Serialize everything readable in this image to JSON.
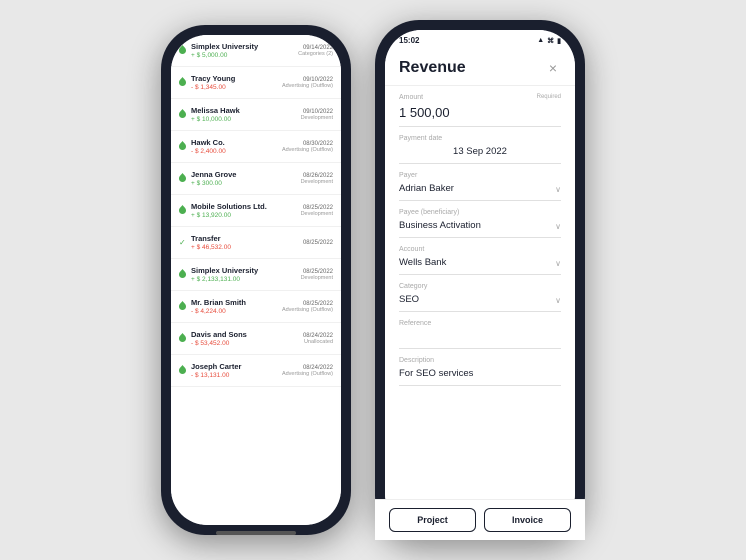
{
  "phone1": {
    "transactions": [
      {
        "id": 1,
        "name": "Simplex University",
        "amount": "+ $ 5,000.00",
        "type": "positive",
        "date": "09/14/2022",
        "category": "Categories (2)",
        "icon": "leaf"
      },
      {
        "id": 2,
        "name": "Tracy Young",
        "amount": "- $ 1,345.00",
        "type": "negative",
        "date": "09/10/2022",
        "category": "Advertising (Outflow)",
        "icon": "leaf"
      },
      {
        "id": 3,
        "name": "Melissa Hawk",
        "amount": "+ $ 10,000.00",
        "type": "positive",
        "date": "09/10/2022",
        "category": "Development",
        "icon": "leaf"
      },
      {
        "id": 4,
        "name": "Hawk Co.",
        "amount": "- $ 2,400.00",
        "type": "negative",
        "date": "08/30/2022",
        "category": "Advertising (Outflow)",
        "icon": "leaf"
      },
      {
        "id": 5,
        "name": "Jenna Grove",
        "amount": "+ $ 300.00",
        "type": "positive",
        "date": "08/26/2022",
        "category": "Development",
        "icon": "leaf"
      },
      {
        "id": 6,
        "name": "Mobile Solutions Ltd.",
        "amount": "+ $ 13,920.00",
        "type": "positive",
        "date": "08/25/2022",
        "category": "Development",
        "icon": "leaf"
      },
      {
        "id": 7,
        "name": "Transfer",
        "amount": "+ $ 46,532.00",
        "type": "negative",
        "date": "08/25/2022",
        "category": "",
        "icon": "check"
      },
      {
        "id": 8,
        "name": "Simplex University",
        "amount": "+ $ 2,133,131.00",
        "type": "positive",
        "date": "08/25/2022",
        "category": "Development",
        "icon": "leaf"
      },
      {
        "id": 9,
        "name": "Mr. Brian Smith",
        "amount": "- $ 4,224.00",
        "type": "negative",
        "date": "08/25/2022",
        "category": "Advertising (Outflow)",
        "icon": "leaf"
      },
      {
        "id": 10,
        "name": "Davis and Sons",
        "amount": "- $ 53,452.00",
        "type": "negative",
        "date": "08/24/2022",
        "category": "Unallocated",
        "icon": "leaf"
      },
      {
        "id": 11,
        "name": "Joseph Carter",
        "amount": "- $ 13,131.00",
        "type": "negative",
        "date": "08/24/2022",
        "category": "Advertising (Outflow)",
        "icon": "leaf"
      }
    ]
  },
  "phone2": {
    "statusBar": {
      "time": "15:02",
      "signal": "●●●",
      "wifi": "wifi",
      "battery": "▮▮▮"
    },
    "form": {
      "title": "Revenue",
      "close_label": "×",
      "fields": {
        "amount_label": "Amount",
        "amount_value": "1 500,00",
        "amount_required": "Required",
        "payment_date_label": "Payment date",
        "payment_date_value": "13 Sep 2022",
        "payer_label": "Payer",
        "payer_value": "Adrian Baker",
        "payee_label": "Payee (beneficiary)",
        "payee_value": "Business Activation",
        "account_label": "Account",
        "account_value": "Wells Bank",
        "category_label": "Category",
        "category_value": "SEO",
        "reference_label": "Reference",
        "reference_placeholder": "",
        "description_label": "Description",
        "description_value": "For SEO services"
      },
      "footer": {
        "project_label": "Project",
        "invoice_label": "Invoice"
      }
    }
  }
}
